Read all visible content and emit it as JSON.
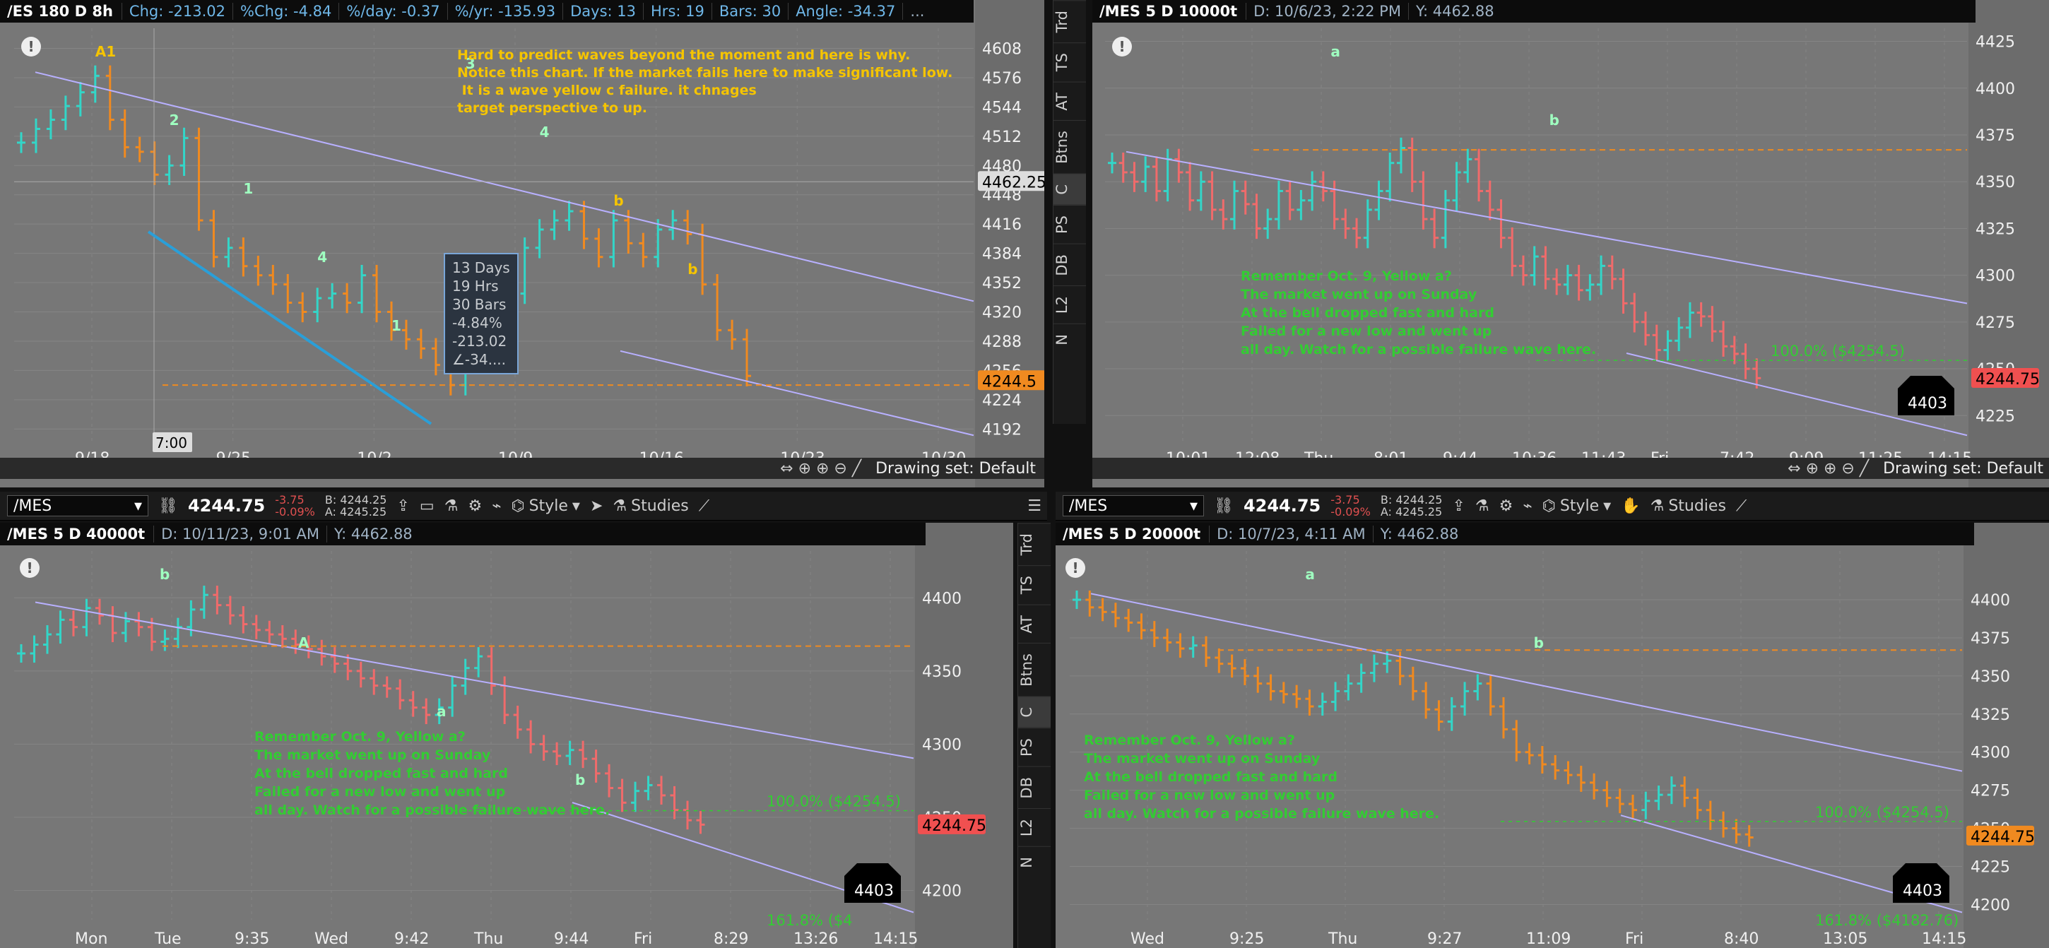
{
  "colors": {
    "bg": "#777777",
    "up": "#33d6c8",
    "down_orange": "#f08a20",
    "down_red": "#f06b6b",
    "channel": "#b8b0ff",
    "dash": "#f08a20",
    "annotation_yellow": "#f5c400",
    "annotation_green": "#33cc33",
    "price_tag_orange": "#f08a20",
    "price_tag_red": "#f05050"
  },
  "toolbar": {
    "symbol": "/MES",
    "price": "4244.75",
    "change": "-3.75",
    "change_pct": "-0.09%",
    "bid": "B: 4244.25",
    "ask": "A: 4245.25",
    "style_label": "Style",
    "studies_label": "Studies"
  },
  "sidebar_tabs": [
    "Trd",
    "TS",
    "AT",
    "Btns",
    "C",
    "PS",
    "DB",
    "L2",
    "N"
  ],
  "drawing_set": "Drawing set: Default",
  "panels": {
    "tl": {
      "header": {
        "symbol": "/ES 180 D 8h",
        "chg": "Chg: -213.02",
        "pct_chg": "%Chg: -4.84",
        "pct_day": "%/day: -0.37",
        "pct_yr": "%/yr: -135.93",
        "days": "Days: 13",
        "hrs": "Hrs: 19",
        "bars": "Bars: 30",
        "angle": "Angle: -34.37",
        "more": "..."
      },
      "note": "Hard to predict waves beyond the moment and here is why.\nNotice this chart. If the market fails here to make significant low.\n It is a wave yellow c failure. it chnages\ntarget perspective to up.",
      "bubble": [
        "13 Days",
        "19 Hrs",
        "30 Bars",
        "-4.84%",
        "-213.02",
        "∠-34...."
      ],
      "labels": [
        "A1",
        "2",
        "1",
        "4",
        "1",
        "3",
        "4",
        "b",
        "b"
      ],
      "crosshair_price": "4462.25",
      "crosshair_time": "7:00",
      "last_price": "4244.5"
    },
    "tr": {
      "header": {
        "symbol": "/MES 5 D 10000t",
        "date": "D: 10/6/23, 2:22 PM",
        "y": "Y: 4462.88"
      },
      "note": "Remember Oct. 9, Yellow a?\nThe market went up on Sunday\nAt the bell dropped fast and hard\nFailed for a new low and went up\nall day. Watch for a possible failure wave here.",
      "fib": "100.0%  ($4254.5)",
      "box_value": "4403",
      "last_price": "4244.75",
      "labels": [
        "a",
        "b"
      ]
    },
    "bl": {
      "header": {
        "symbol": "/MES 5 D 40000t",
        "date": "D: 10/11/23, 9:01 AM",
        "y": "Y: 4462.88"
      },
      "note": "Remember Oct. 9, Yellow a?\nThe market went up on Sunday\nAt the bell dropped fast and hard\nFailed for a new low and went up\nall day. Watch for a possible failure wave here.",
      "fib100": "100.0%  ($4254.5)",
      "fib161": "161.8%  ($4",
      "box_value": "4403",
      "last_price": "4244.75",
      "labels": [
        "b",
        "A",
        "a",
        "b"
      ]
    },
    "br": {
      "header": {
        "symbol": "/MES 5 D 20000t",
        "date": "D: 10/7/23, 4:11 AM",
        "y": "Y: 4462.88"
      },
      "note": "Remember Oct. 9, Yellow a?\nThe market went up on Sunday\nAt the bell dropped fast and hard\nFailed for a new low and went up\nall day. Watch for a possible failure wave here.",
      "fib100": "100.0%  ($4254.5)",
      "fib161": "161.8%  ($4182.76)",
      "box_value": "4403",
      "last_price": "4244.75",
      "labels": [
        "a",
        "b"
      ]
    }
  },
  "chart_data": [
    {
      "type": "ohlc",
      "panel": "tl",
      "x_ticks": [
        "9/18",
        "9/25",
        "10/2",
        "10/9",
        "10/16",
        "10/23",
        "10/30"
      ],
      "y_ticks": [
        4608,
        4576,
        4544,
        4512,
        4480,
        4448,
        4416,
        4384,
        4352,
        4320,
        4288,
        4256,
        4224,
        4192
      ],
      "ylim": [
        4176,
        4630
      ],
      "closes": [
        4505,
        4520,
        4530,
        4545,
        4560,
        4578,
        4530,
        4500,
        4495,
        4470,
        4480,
        4510,
        4420,
        4380,
        4390,
        4370,
        4360,
        4350,
        4330,
        4320,
        4335,
        4340,
        4330,
        4360,
        4320,
        4300,
        4290,
        4280,
        4262,
        4240,
        4275,
        4300,
        4320,
        4340,
        4390,
        4410,
        4420,
        4430,
        4400,
        4380,
        4420,
        4395,
        4380,
        4410,
        4420,
        4405,
        4350,
        4300,
        4290,
        4250
      ]
    },
    {
      "type": "ohlc",
      "panel": "tr",
      "x_ticks": [
        "10:01",
        "12:08",
        "Thu",
        "8:01",
        "9:44",
        "10:36",
        "11:43",
        "Fri",
        "7:42",
        "9:09",
        "11:25",
        "14:15"
      ],
      "y_ticks": [
        4425,
        4400,
        4375,
        4350,
        4325,
        4300,
        4275,
        4250,
        4225
      ],
      "ylim": [
        4210,
        4432
      ],
      "closes": [
        4360,
        4355,
        4350,
        4358,
        4345,
        4362,
        4355,
        4340,
        4350,
        4335,
        4330,
        4345,
        4338,
        4325,
        4330,
        4345,
        4335,
        4340,
        4350,
        4345,
        4330,
        4325,
        4320,
        4335,
        4345,
        4360,
        4368,
        4350,
        4330,
        4320,
        4340,
        4355,
        4362,
        4345,
        4335,
        4320,
        4305,
        4300,
        4310,
        4298,
        4295,
        4300,
        4292,
        4295,
        4305,
        4298,
        4285,
        4275,
        4268,
        4260,
        4265,
        4272,
        4280,
        4278,
        4270,
        4262,
        4258,
        4250,
        4245
      ]
    },
    {
      "type": "ohlc",
      "panel": "bl",
      "x_ticks": [
        "Mon",
        "Tue",
        "9:35",
        "Wed",
        "9:42",
        "Thu",
        "9:44",
        "Fri",
        "8:29",
        "13:26",
        "14:15"
      ],
      "y_ticks": [
        4400,
        4350,
        4300,
        4250,
        4200
      ],
      "ylim": [
        4180,
        4432
      ],
      "closes": [
        4362,
        4368,
        4375,
        4385,
        4380,
        4393,
        4388,
        4376,
        4384,
        4380,
        4370,
        4372,
        4380,
        4392,
        4402,
        4395,
        4388,
        4382,
        4378,
        4375,
        4372,
        4368,
        4365,
        4360,
        4355,
        4350,
        4345,
        4340,
        4338,
        4330,
        4325,
        4320,
        4325,
        4340,
        4352,
        4360,
        4340,
        4320,
        4310,
        4300,
        4295,
        4292,
        4296,
        4290,
        4280,
        4270,
        4260,
        4268,
        4272,
        4265,
        4255,
        4248,
        4245
      ]
    },
    {
      "type": "ohlc",
      "panel": "br",
      "x_ticks": [
        "Wed",
        "9:25",
        "Thu",
        "9:27",
        "11:09",
        "Fri",
        "8:40",
        "13:05",
        "14:15"
      ],
      "y_ticks": [
        4400,
        4375,
        4350,
        4325,
        4300,
        4275,
        4250,
        4225,
        4200
      ],
      "ylim": [
        4190,
        4432
      ],
      "closes": [
        4400,
        4395,
        4392,
        4388,
        4385,
        4380,
        4375,
        4372,
        4368,
        4370,
        4362,
        4358,
        4355,
        4350,
        4345,
        4340,
        4338,
        4335,
        4330,
        4333,
        4340,
        4345,
        4352,
        4358,
        4360,
        4350,
        4340,
        4328,
        4320,
        4330,
        4340,
        4345,
        4330,
        4315,
        4300,
        4298,
        4292,
        4288,
        4285,
        4280,
        4275,
        4270,
        4266,
        4262,
        4268,
        4272,
        4278,
        4270,
        4262,
        4255,
        4250,
        4246,
        4244
      ]
    }
  ]
}
